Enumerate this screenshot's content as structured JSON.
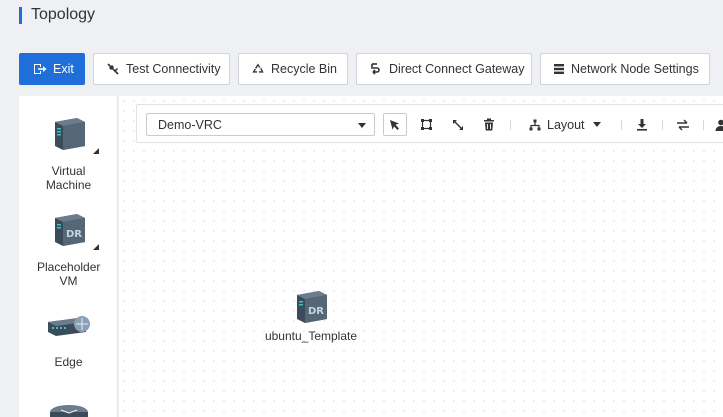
{
  "page": {
    "title": "Topology"
  },
  "toolbar": {
    "exit": "Exit",
    "test_connectivity": "Test Connectivity",
    "recycle_bin": "Recycle Bin",
    "direct_connect_gateway": "Direct Connect Gateway",
    "network_node_settings": "Network Node Settings"
  },
  "palette": {
    "items": [
      {
        "label": "Virtual Machine",
        "icon": "virtual-machine-icon"
      },
      {
        "label": "Placeholder VM",
        "icon": "dr-placeholder-icon"
      },
      {
        "label": "Edge",
        "icon": "edge-router-icon"
      },
      {
        "label": "",
        "icon": "router-icon"
      }
    ]
  },
  "topology": {
    "selected_vrc": "Demo-VRC",
    "layout_label": "Layout",
    "tools": [
      "pointer-icon",
      "select-area-icon",
      "resize-icon",
      "delete-icon",
      "layout-icon",
      "download-icon",
      "swap-icon",
      "user-icon"
    ]
  },
  "canvas": {
    "nodes": [
      {
        "label": "ubuntu_Template",
        "icon": "dr-placeholder-icon"
      }
    ]
  },
  "colors": {
    "primary": "#1e6fd9",
    "icon_dark": "#3b4b5a",
    "icon_accent": "#39c3c6"
  }
}
